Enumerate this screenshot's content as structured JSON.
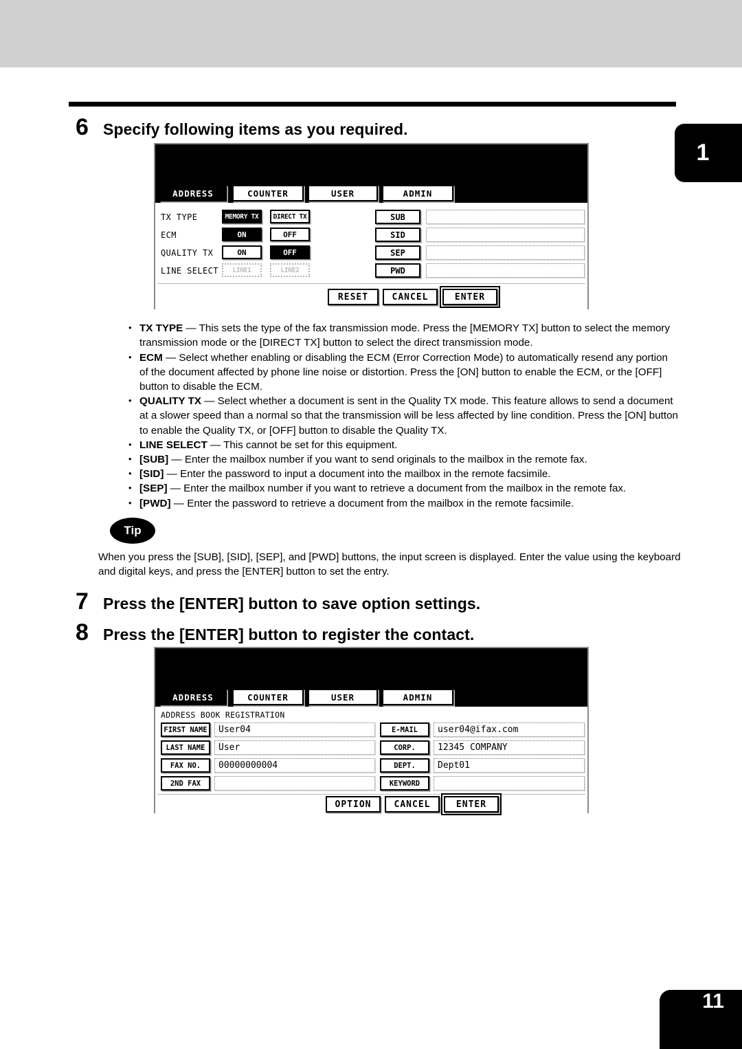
{
  "page": {
    "chapter_marker": "1",
    "page_number": "11"
  },
  "steps": [
    {
      "num": "6",
      "text": "Specify following items as you required."
    },
    {
      "num": "7",
      "text": "Press the [ENTER] button to save option settings."
    },
    {
      "num": "8",
      "text": "Press the [ENTER] button to register the contact."
    }
  ],
  "bullets": [
    {
      "term": "TX TYPE",
      "rest": " — This sets the type of the fax transmission mode.  Press the [MEMORY TX] button to select the memory transmission mode or the [DIRECT TX] button to select the direct transmission mode."
    },
    {
      "term": "ECM",
      "rest": " — Select whether enabling or disabling the ECM (Error Correction Mode) to automatically resend any portion of the document affected by phone line noise or distortion.  Press the [ON] button to enable the ECM, or the [OFF] button to disable the ECM."
    },
    {
      "term": "QUALITY TX",
      "rest": " — Select whether a document is sent in the Quality TX mode. This feature allows to send a document at a slower speed than a normal so that the transmission will be less affected by line condition.  Press the [ON] button to enable the Quality TX, or [OFF] button to disable the Quality TX."
    },
    {
      "term": "LINE SELECT",
      "rest": " — This cannot be set for this equipment."
    },
    {
      "term": "[SUB]",
      "rest": " — Enter the mailbox number if you want to send originals to the mailbox in the remote fax."
    },
    {
      "term": "[SID]",
      "rest": " — Enter the password to input a document into the mailbox in the remote facsimile."
    },
    {
      "term": "[SEP]",
      "rest": " — Enter the mailbox number if you want to retrieve a document from the mailbox in the remote fax."
    },
    {
      "term": "[PWD]",
      "rest": " — Enter the password to retrieve a document from the mailbox in the remote facsimile."
    }
  ],
  "tip": {
    "badge": "Tip",
    "text": "When you press the [SUB], [SID], [SEP], and [PWD] buttons, the input screen is displayed.  Enter the value using the keyboard and digital keys, and press the [ENTER] button to set the entry."
  },
  "panel1": {
    "tabs": [
      {
        "label": "ADDRESS",
        "selected": true
      },
      {
        "label": "COUNTER",
        "selected": false
      },
      {
        "label": "USER",
        "selected": false
      },
      {
        "label": "ADMIN",
        "selected": false
      }
    ],
    "rows": [
      {
        "label": "TX TYPE",
        "opt1": "MEMORY TX",
        "opt1_state": "selected",
        "opt2": "DIRECT TX",
        "opt2_state": "normal"
      },
      {
        "label": "ECM",
        "opt1": "ON",
        "opt1_state": "selected",
        "opt2": "OFF",
        "opt2_state": "normal"
      },
      {
        "label": "QUALITY TX",
        "opt1": "ON",
        "opt1_state": "normal",
        "opt2": "OFF",
        "opt2_state": "selected"
      },
      {
        "label": "LINE SELECT",
        "opt1": "LINE1",
        "opt1_state": "disabled",
        "opt2": "LINE2",
        "opt2_state": "disabled"
      }
    ],
    "mailbox_fields": [
      {
        "key": "SUB",
        "value": ""
      },
      {
        "key": "SID",
        "value": ""
      },
      {
        "key": "SEP",
        "value": ""
      },
      {
        "key": "PWD",
        "value": ""
      }
    ],
    "actions": [
      {
        "label": "RESET",
        "focused": false
      },
      {
        "label": "CANCEL",
        "focused": false
      },
      {
        "label": "ENTER",
        "focused": true
      }
    ]
  },
  "panel2": {
    "tabs": [
      {
        "label": "ADDRESS",
        "selected": true
      },
      {
        "label": "COUNTER",
        "selected": false
      },
      {
        "label": "USER",
        "selected": false
      },
      {
        "label": "ADMIN",
        "selected": false
      }
    ],
    "title": "ADDRESS BOOK REGISTRATION",
    "left_fields": [
      {
        "key": "FIRST NAME",
        "value": "User04"
      },
      {
        "key": "LAST NAME",
        "value": "User"
      },
      {
        "key": "FAX NO.",
        "value": "00000000004"
      },
      {
        "key": "2ND FAX",
        "value": ""
      }
    ],
    "right_fields": [
      {
        "key": "E-MAIL",
        "value": "user04@ifax.com"
      },
      {
        "key": "CORP.",
        "value": "12345 COMPANY"
      },
      {
        "key": "DEPT.",
        "value": "Dept01"
      },
      {
        "key": "KEYWORD",
        "value": ""
      }
    ],
    "actions": [
      {
        "label": "OPTION",
        "focused": false
      },
      {
        "label": "CANCEL",
        "focused": false
      },
      {
        "label": "ENTER",
        "focused": true
      }
    ]
  },
  "colors": {
    "band": "#d0d0d0",
    "ink": "#000000",
    "panel_border": "#8a8a8a"
  }
}
